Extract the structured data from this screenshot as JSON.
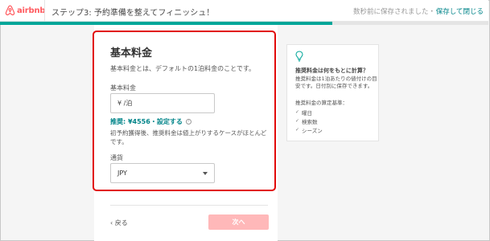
{
  "header": {
    "logo_text": "airbnb",
    "step_title": "ステップ3: 予約準備を整えてフィニッシュ！",
    "saved_text": "数秒前に保存されました・",
    "save_close_label": "保存して閉じる"
  },
  "progress": {
    "value": 0.68
  },
  "form": {
    "title": "基本料金",
    "description": "基本料金とは、デフォルトの1泊料金のことです。",
    "price_label": "基本料金",
    "price_placeholder": "¥ /泊",
    "suggestion_text": "推奨: ¥4556・設定する",
    "suggestion_help": "?",
    "note": "初予約獲得後、推奨料金は値上がりするケースがほとんどです。",
    "currency_label": "通貨",
    "currency_value": "JPY",
    "back_label": "‹ 戻る",
    "next_label": "次へ"
  },
  "tip": {
    "title": "推奨料金は何をもとに計算？",
    "body": "推奨料金は1泊あたりの値付けの目安です。日付別に保存できます。",
    "criteria_heading": "推奨料金の算定基準：",
    "criteria": [
      "曜日",
      "検索数",
      "シーズン"
    ]
  },
  "colors": {
    "brand": "#ff5a5f",
    "accent": "#008489",
    "progress": "#00a699",
    "highlight": "#e10a0a"
  },
  "icons": {
    "logo": "airbnb-logo-icon",
    "tip": "lightbulb-icon",
    "select": "chevron-down-icon",
    "check": "checkmark-icon"
  }
}
